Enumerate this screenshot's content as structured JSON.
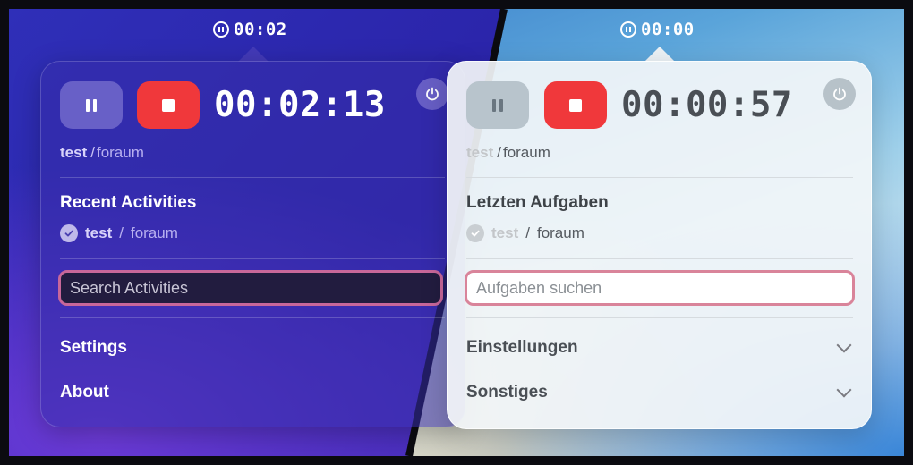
{
  "left": {
    "status_timer": "00:02",
    "elapsed": "00:02:13",
    "current_task": "test",
    "current_project": "foraum",
    "recent_title": "Recent Activities",
    "recent": [
      {
        "task": "test",
        "project": "foraum"
      }
    ],
    "search_placeholder": "Search Activities",
    "menu": [
      "Settings",
      "About"
    ]
  },
  "right": {
    "status_timer": "00:00",
    "elapsed": "00:00:57",
    "current_task": "test",
    "current_project": "foraum",
    "recent_title": "Letzten Aufgaben",
    "recent": [
      {
        "task": "test",
        "project": "foraum"
      }
    ],
    "search_placeholder": "Aufgaben suchen",
    "menu": [
      "Einstellungen",
      "Sonstiges"
    ]
  },
  "separator": "/",
  "colors": {
    "stop_red": "#f0383b",
    "search_border_pink": "#d9849a",
    "dark_panel": "#372daa",
    "light_panel": "#f3f6f8"
  },
  "icons": [
    "pause-circle-icon",
    "pause-icon",
    "stop-icon",
    "power-icon",
    "checkmark-circle-icon",
    "chevron-down-icon"
  ]
}
